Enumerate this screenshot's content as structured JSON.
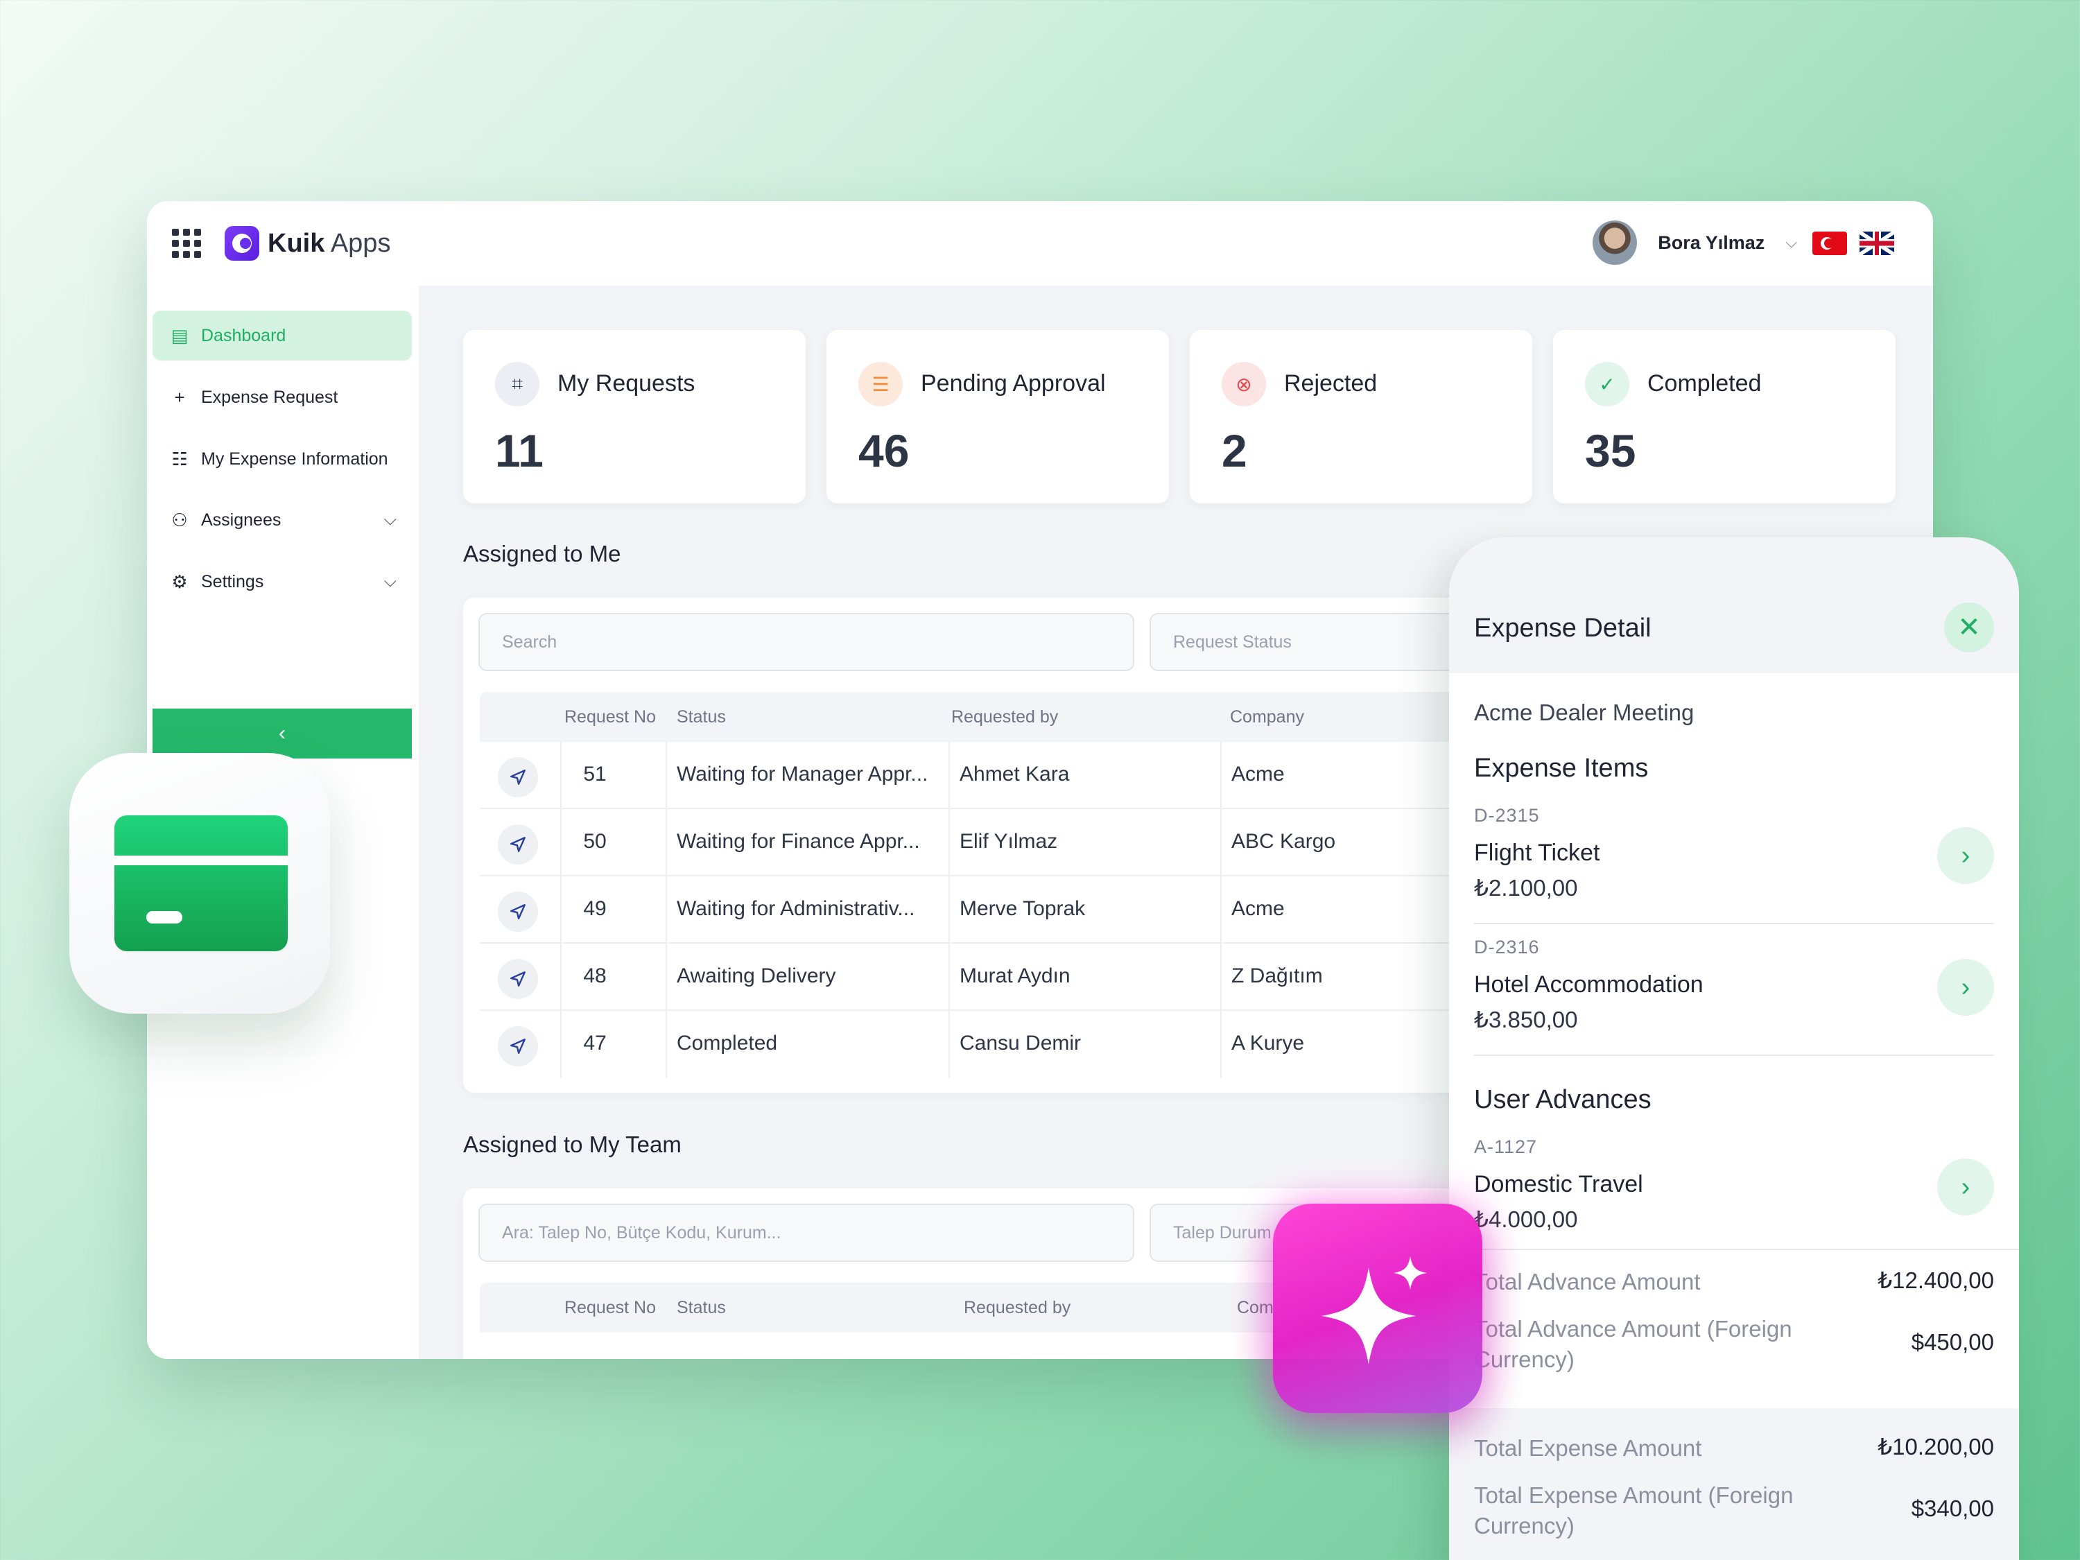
{
  "app": {
    "name_bold": "Kuik",
    "name_light": "Apps"
  },
  "user": {
    "name": "Bora Yılmaz"
  },
  "sidebar": {
    "items": [
      {
        "label": "Dashboard"
      },
      {
        "label": "Expense Request"
      },
      {
        "label": "My Expense Information"
      },
      {
        "label": "Assignees"
      },
      {
        "label": "Settings"
      }
    ],
    "collapse_label": "‹"
  },
  "stats": [
    {
      "title": "My Requests",
      "value": "11"
    },
    {
      "title": "Pending Approval",
      "value": "46"
    },
    {
      "title": "Rejected",
      "value": "2"
    },
    {
      "title": "Completed",
      "value": "35"
    }
  ],
  "assigned_to_me": {
    "title": "Assigned to Me",
    "search_placeholder": "Search",
    "status_placeholder": "Request Status",
    "columns": [
      "Request No",
      "Status",
      "Requested by",
      "Company"
    ],
    "rows": [
      {
        "no": "51",
        "status": "Waiting for Manager Appr...",
        "by": "Ahmet Kara",
        "company": "Acme"
      },
      {
        "no": "50",
        "status": "Waiting for Finance Appr...",
        "by": "Elif Yılmaz",
        "company": "ABC Kargo"
      },
      {
        "no": "49",
        "status": "Waiting for Administrativ...",
        "by": "Merve Toprak",
        "company": "Acme"
      },
      {
        "no": "48",
        "status": "Awaiting Delivery",
        "by": "Murat Aydın",
        "company": "Z Dağıtım"
      },
      {
        "no": "47",
        "status": "Completed",
        "by": "Cansu Demir",
        "company": "A Kurye"
      }
    ]
  },
  "assigned_to_team": {
    "title": "Assigned to My Team",
    "search_placeholder": "Ara: Talep No, Bütçe Kodu, Kurum...",
    "status_placeholder": "Talep Durum",
    "columns": [
      "Request No",
      "Status",
      "Requested by",
      "Com"
    ]
  },
  "detail": {
    "title": "Expense Detail",
    "subtitle": "Acme Dealer Meeting",
    "items_title": "Expense Items",
    "items": [
      {
        "code": "D-2315",
        "name": "Flight Ticket",
        "amount": "₺2.100,00"
      },
      {
        "code": "D-2316",
        "name": "Hotel Accommodation",
        "amount": "₺3.850,00"
      }
    ],
    "advances_title": "User Advances",
    "advances": [
      {
        "code": "A-1127",
        "name": "Domestic Travel",
        "amount": "₺4.000,00"
      }
    ],
    "totals_advance": [
      {
        "label": "Total Advance Amount",
        "value": "₺12.400,00"
      },
      {
        "label": "Total Advance Amount (Foreign Currency)",
        "value": "$450,00"
      }
    ],
    "totals_expense": [
      {
        "label": "Total Expense Amount",
        "value": "₺10.200,00"
      },
      {
        "label": "Total Expense Amount (Foreign Currency)",
        "value": "$340,00"
      }
    ]
  }
}
